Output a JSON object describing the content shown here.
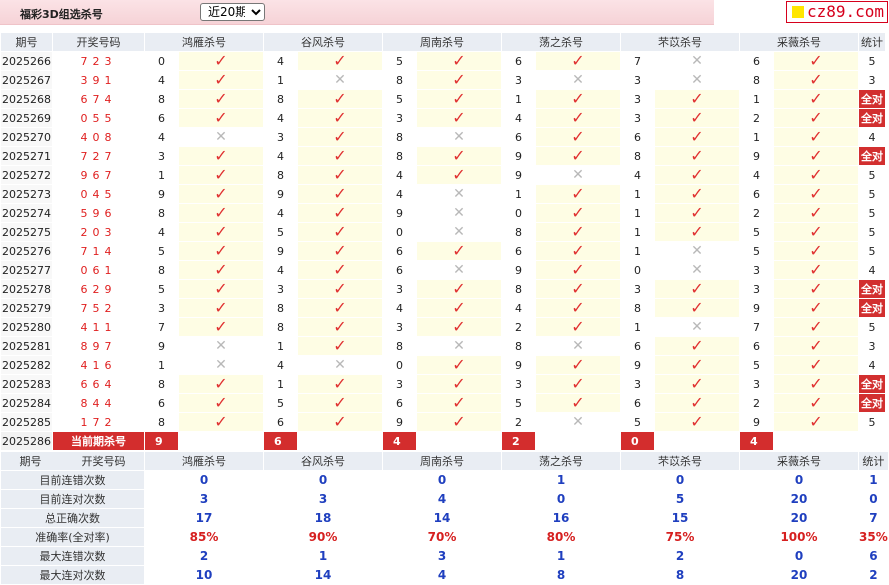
{
  "header": {
    "title": "福彩3D组选杀号",
    "period_option": "近20期",
    "logo_text": "cz89.com"
  },
  "columns": [
    "期号",
    "开奖号码",
    "鸿雁杀号",
    "谷风杀号",
    "周南杀号",
    "荡之杀号",
    "芣苡杀号",
    "采薇杀号",
    "统计"
  ],
  "rows": [
    {
      "issue": "2025266",
      "draw": "723",
      "kills": [
        [
          "0",
          true
        ],
        [
          "4",
          true
        ],
        [
          "5",
          true
        ],
        [
          "6",
          true
        ],
        [
          "7",
          false
        ],
        [
          "6",
          true
        ]
      ],
      "stat": "5",
      "full": false
    },
    {
      "issue": "2025267",
      "draw": "391",
      "kills": [
        [
          "4",
          true
        ],
        [
          "1",
          false
        ],
        [
          "8",
          true
        ],
        [
          "3",
          false
        ],
        [
          "3",
          false
        ],
        [
          "8",
          true
        ]
      ],
      "stat": "3",
      "full": false
    },
    {
      "issue": "2025268",
      "draw": "674",
      "kills": [
        [
          "8",
          true
        ],
        [
          "8",
          true
        ],
        [
          "5",
          true
        ],
        [
          "1",
          true
        ],
        [
          "3",
          true
        ],
        [
          "1",
          true
        ]
      ],
      "stat": "全对",
      "full": true
    },
    {
      "issue": "2025269",
      "draw": "055",
      "kills": [
        [
          "6",
          true
        ],
        [
          "4",
          true
        ],
        [
          "3",
          true
        ],
        [
          "4",
          true
        ],
        [
          "3",
          true
        ],
        [
          "2",
          true
        ]
      ],
      "stat": "全对",
      "full": true
    },
    {
      "issue": "2025270",
      "draw": "408",
      "kills": [
        [
          "4",
          false
        ],
        [
          "3",
          true
        ],
        [
          "8",
          false
        ],
        [
          "6",
          true
        ],
        [
          "6",
          true
        ],
        [
          "1",
          true
        ]
      ],
      "stat": "4",
      "full": false
    },
    {
      "issue": "2025271",
      "draw": "727",
      "kills": [
        [
          "3",
          true
        ],
        [
          "4",
          true
        ],
        [
          "8",
          true
        ],
        [
          "9",
          true
        ],
        [
          "8",
          true
        ],
        [
          "9",
          true
        ]
      ],
      "stat": "全对",
      "full": true
    },
    {
      "issue": "2025272",
      "draw": "967",
      "kills": [
        [
          "1",
          true
        ],
        [
          "8",
          true
        ],
        [
          "4",
          true
        ],
        [
          "9",
          false
        ],
        [
          "4",
          true
        ],
        [
          "4",
          true
        ]
      ],
      "stat": "5",
      "full": false
    },
    {
      "issue": "2025273",
      "draw": "045",
      "kills": [
        [
          "9",
          true
        ],
        [
          "9",
          true
        ],
        [
          "4",
          false
        ],
        [
          "1",
          true
        ],
        [
          "1",
          true
        ],
        [
          "6",
          true
        ]
      ],
      "stat": "5",
      "full": false
    },
    {
      "issue": "2025274",
      "draw": "596",
      "kills": [
        [
          "8",
          true
        ],
        [
          "4",
          true
        ],
        [
          "9",
          false
        ],
        [
          "0",
          true
        ],
        [
          "1",
          true
        ],
        [
          "2",
          true
        ]
      ],
      "stat": "5",
      "full": false
    },
    {
      "issue": "2025275",
      "draw": "203",
      "kills": [
        [
          "4",
          true
        ],
        [
          "5",
          true
        ],
        [
          "0",
          false
        ],
        [
          "8",
          true
        ],
        [
          "1",
          true
        ],
        [
          "5",
          true
        ]
      ],
      "stat": "5",
      "full": false
    },
    {
      "issue": "2025276",
      "draw": "714",
      "kills": [
        [
          "5",
          true
        ],
        [
          "9",
          true
        ],
        [
          "6",
          true
        ],
        [
          "6",
          true
        ],
        [
          "1",
          false
        ],
        [
          "5",
          true
        ]
      ],
      "stat": "5",
      "full": false
    },
    {
      "issue": "2025277",
      "draw": "061",
      "kills": [
        [
          "8",
          true
        ],
        [
          "4",
          true
        ],
        [
          "6",
          false
        ],
        [
          "9",
          true
        ],
        [
          "0",
          false
        ],
        [
          "3",
          true
        ]
      ],
      "stat": "4",
      "full": false
    },
    {
      "issue": "2025278",
      "draw": "629",
      "kills": [
        [
          "5",
          true
        ],
        [
          "3",
          true
        ],
        [
          "3",
          true
        ],
        [
          "8",
          true
        ],
        [
          "3",
          true
        ],
        [
          "3",
          true
        ]
      ],
      "stat": "全对",
      "full": true
    },
    {
      "issue": "2025279",
      "draw": "752",
      "kills": [
        [
          "3",
          true
        ],
        [
          "8",
          true
        ],
        [
          "4",
          true
        ],
        [
          "4",
          true
        ],
        [
          "8",
          true
        ],
        [
          "9",
          true
        ]
      ],
      "stat": "全对",
      "full": true
    },
    {
      "issue": "2025280",
      "draw": "411",
      "kills": [
        [
          "7",
          true
        ],
        [
          "8",
          true
        ],
        [
          "3",
          true
        ],
        [
          "2",
          true
        ],
        [
          "1",
          false
        ],
        [
          "7",
          true
        ]
      ],
      "stat": "5",
      "full": false
    },
    {
      "issue": "2025281",
      "draw": "897",
      "kills": [
        [
          "9",
          false
        ],
        [
          "1",
          true
        ],
        [
          "8",
          false
        ],
        [
          "8",
          false
        ],
        [
          "6",
          true
        ],
        [
          "6",
          true
        ]
      ],
      "stat": "3",
      "full": false
    },
    {
      "issue": "2025282",
      "draw": "416",
      "kills": [
        [
          "1",
          false
        ],
        [
          "4",
          false
        ],
        [
          "0",
          true
        ],
        [
          "9",
          true
        ],
        [
          "9",
          true
        ],
        [
          "5",
          true
        ]
      ],
      "stat": "4",
      "full": false
    },
    {
      "issue": "2025283",
      "draw": "664",
      "kills": [
        [
          "8",
          true
        ],
        [
          "1",
          true
        ],
        [
          "3",
          true
        ],
        [
          "3",
          true
        ],
        [
          "3",
          true
        ],
        [
          "3",
          true
        ]
      ],
      "stat": "全对",
      "full": true
    },
    {
      "issue": "2025284",
      "draw": "844",
      "kills": [
        [
          "6",
          true
        ],
        [
          "5",
          true
        ],
        [
          "6",
          true
        ],
        [
          "5",
          true
        ],
        [
          "6",
          true
        ],
        [
          "2",
          true
        ]
      ],
      "stat": "全对",
      "full": true
    },
    {
      "issue": "2025285",
      "draw": "172",
      "kills": [
        [
          "8",
          true
        ],
        [
          "6",
          true
        ],
        [
          "9",
          true
        ],
        [
          "2",
          false
        ],
        [
          "5",
          true
        ],
        [
          "9",
          true
        ]
      ],
      "stat": "5",
      "full": false
    }
  ],
  "current": {
    "issue": "2025286",
    "label": "当前期杀号",
    "kills": [
      "9",
      "6",
      "4",
      "2",
      "0",
      "4"
    ]
  },
  "summary": {
    "header": [
      "期号",
      "开奖号码",
      "鸿雁杀号",
      "谷风杀号",
      "周南杀号",
      "荡之杀号",
      "芣苡杀号",
      "采薇杀号",
      "统计"
    ],
    "rows": [
      {
        "label": "目前连错次数",
        "values": [
          "0",
          "0",
          "0",
          "1",
          "0",
          "0",
          "1"
        ],
        "color": "blue"
      },
      {
        "label": "目前连对次数",
        "values": [
          "3",
          "3",
          "4",
          "0",
          "5",
          "20",
          "0"
        ],
        "color": "blue"
      },
      {
        "label": "总正确次数",
        "values": [
          "17",
          "18",
          "14",
          "16",
          "15",
          "20",
          "7"
        ],
        "color": "blue"
      },
      {
        "label": "准确率(全对率)",
        "values": [
          "85%",
          "90%",
          "70%",
          "80%",
          "75%",
          "100%",
          "35%"
        ],
        "color": "red"
      },
      {
        "label": "最大连错次数",
        "values": [
          "2",
          "1",
          "3",
          "1",
          "2",
          "0",
          "6"
        ],
        "color": "blue"
      },
      {
        "label": "最大连对次数",
        "values": [
          "10",
          "14",
          "4",
          "8",
          "8",
          "20",
          "2"
        ],
        "color": "blue"
      }
    ]
  },
  "icons": {
    "hit": "check-icon",
    "miss": "cross-icon"
  },
  "colors": {
    "accent": "#d32d2d",
    "hit_bg": "#fefde4",
    "header_bg": "#e9edf3",
    "blue_value": "#1f3fbf",
    "red_value": "#d62020"
  }
}
